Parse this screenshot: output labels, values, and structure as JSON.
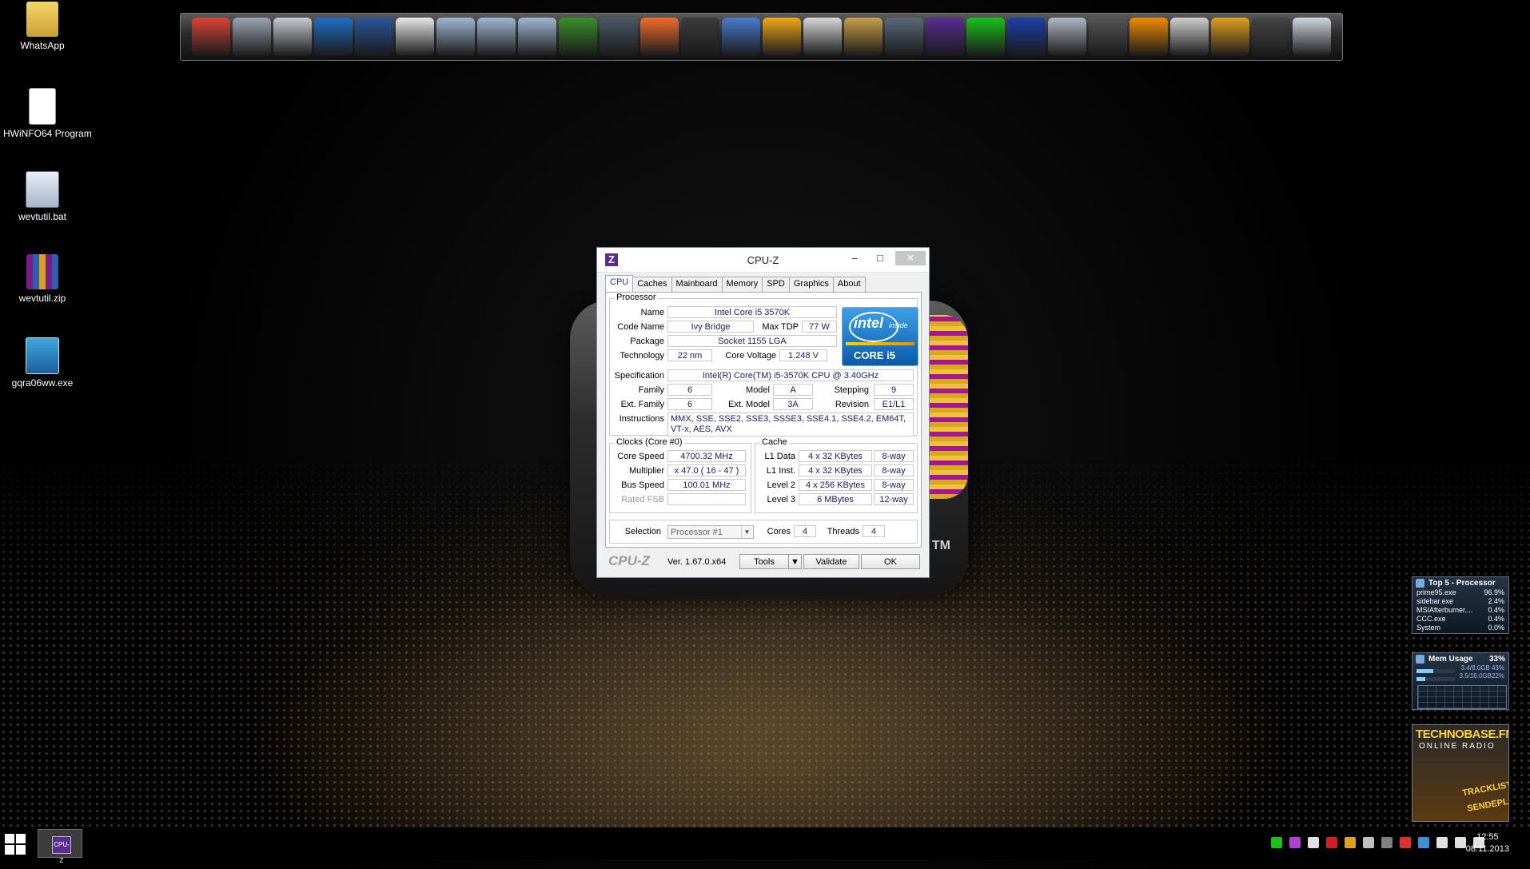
{
  "desktop": {
    "icons": [
      {
        "label": "WhatsApp",
        "icon": "folder-icon"
      },
      {
        "label": "HWiNFO64 Program",
        "icon": "document-icon"
      },
      {
        "label": "wevtutil.bat",
        "icon": "batch-file-icon"
      },
      {
        "label": "wevtutil.zip",
        "icon": "archive-icon"
      },
      {
        "label": "gqra06ww.exe",
        "icon": "installer-icon"
      }
    ]
  },
  "dock": {
    "icons": [
      {
        "name": "chrome-icon",
        "color": "#db4437"
      },
      {
        "name": "drive-icon",
        "color": "#9aa4b0"
      },
      {
        "name": "drive-icon",
        "color": "#c7ccd2"
      },
      {
        "name": "outlook-icon",
        "color": "#1f6fc5"
      },
      {
        "name": "word-icon",
        "color": "#2b579a"
      },
      {
        "name": "document-icon",
        "color": "#e8e8e8"
      },
      {
        "name": "folder-icon",
        "color": "#9fb7d4"
      },
      {
        "name": "folder-icon",
        "color": "#9fb7d4"
      },
      {
        "name": "folder-icon",
        "color": "#9fb7d4"
      },
      {
        "name": "xbox-icon",
        "color": "#3a8f2b"
      },
      {
        "name": "soldier-icon",
        "color": "#4a5a66"
      },
      {
        "name": "origin-icon",
        "color": "#f56c2d"
      },
      {
        "name": "game-character-icon",
        "color": "#3b3b3b"
      },
      {
        "name": "monitor-icon",
        "color": "#4a7bd0"
      },
      {
        "name": "gamepad-icon",
        "color": "#f0a818"
      },
      {
        "name": "benchmark-icon",
        "color": "#d9d9d9"
      },
      {
        "name": "hardware-monitor-icon",
        "color": "#c8a04a"
      },
      {
        "name": "audio-icon",
        "color": "#5a6a7a"
      },
      {
        "name": "cpu-z-icon",
        "color": "#5a2d91"
      },
      {
        "name": "prime95-icon",
        "color": "#19c219"
      },
      {
        "name": "lightning-icon",
        "color": "#1c3fa8"
      },
      {
        "name": "tool-icon",
        "color": "#b0b8c4"
      },
      {
        "name": "usb-icon",
        "color": "#555555"
      },
      {
        "name": "vlc-icon",
        "color": "#f08a00"
      },
      {
        "name": "network-icon",
        "color": "#cfcfcf"
      },
      {
        "name": "settings-icon",
        "color": "#e0a020"
      },
      {
        "name": "display-icon",
        "color": "#444444"
      },
      {
        "name": "recycle-bin-icon",
        "color": "#cfd8e0"
      }
    ]
  },
  "cpuz": {
    "title": "CPU-Z",
    "logo": "Z",
    "minimize": "–",
    "maximize": "□",
    "close": "✕",
    "tabs": [
      "CPU",
      "Caches",
      "Mainboard",
      "Memory",
      "SPD",
      "Graphics",
      "About"
    ],
    "processor": {
      "group": "Processor",
      "name_label": "Name",
      "name": "Intel Core i5 3570K",
      "code_name_label": "Code Name",
      "code_name": "Ivy Bridge",
      "max_tdp_label": "Max TDP",
      "max_tdp": "77 W",
      "package_label": "Package",
      "package": "Socket 1155 LGA",
      "technology_label": "Technology",
      "technology": "22 nm",
      "core_voltage_label": "Core Voltage",
      "core_voltage": "1.248 V",
      "specification_label": "Specification",
      "specification": "Intel(R) Core(TM) i5-3570K CPU @ 3.40GHz",
      "family_label": "Family",
      "family": "6",
      "model_label": "Model",
      "model": "A",
      "stepping_label": "Stepping",
      "stepping": "9",
      "ext_family_label": "Ext. Family",
      "ext_family": "6",
      "ext_model_label": "Ext. Model",
      "ext_model": "3A",
      "revision_label": "Revision",
      "revision": "E1/L1",
      "instructions_label": "Instructions",
      "instructions": "MMX, SSE, SSE2, SSE3, SSSE3, SSE4.1, SSE4.2, EM64T, VT-x, AES, AVX"
    },
    "badge": {
      "intel": "intel",
      "inside": "inside",
      "core": "CORE i5"
    },
    "clocks": {
      "group": "Clocks (Core #0)",
      "core_speed_label": "Core Speed",
      "core_speed": "4700.32 MHz",
      "multiplier_label": "Multiplier",
      "multiplier": "x 47.0 ( 16 - 47 )",
      "bus_speed_label": "Bus Speed",
      "bus_speed": "100.01 MHz",
      "rated_fsb_label": "Rated FSB",
      "rated_fsb": ""
    },
    "cache": {
      "group": "Cache",
      "rows": [
        {
          "label": "L1 Data",
          "size": "4 x 32 KBytes",
          "way": "8-way"
        },
        {
          "label": "L1 Inst.",
          "size": "4 x 32 KBytes",
          "way": "8-way"
        },
        {
          "label": "Level 2",
          "size": "4 x 256 KBytes",
          "way": "8-way"
        },
        {
          "label": "Level 3",
          "size": "6 MBytes",
          "way": "12-way"
        }
      ]
    },
    "selection": {
      "label": "Selection",
      "value": "Processor #1",
      "cores_label": "Cores",
      "cores": "4",
      "threads_label": "Threads",
      "threads": "4"
    },
    "footer": {
      "brand": "CPU-Z",
      "version": "Ver. 1.67.0.x64",
      "tools": "Tools",
      "validate": "Validate",
      "ok": "OK"
    }
  },
  "gadgets": {
    "top5": {
      "title": "Top 5 - Processor",
      "rows": [
        {
          "name": "prime95.exe",
          "value": "96.9%"
        },
        {
          "name": "sidebar.exe",
          "value": "2.4%"
        },
        {
          "name": "MSIAfterburner....",
          "value": "0.4%"
        },
        {
          "name": "CCC.exe",
          "value": "0.4%"
        },
        {
          "name": "System",
          "value": "0.0%"
        }
      ]
    },
    "mem": {
      "title": "Mem Usage",
      "percent": "33%",
      "row1": "3.4/8.0GB 43%",
      "row1_fill": 43,
      "row2": "3.5/16.0GB22%",
      "row2_fill": 22
    },
    "radio": {
      "title": "TECHNOBASE.FM",
      "subtitle": "ONLINE RADIO",
      "line1": "TRACKLIST",
      "line2": "SENDEPLAN"
    }
  },
  "taskbar": {
    "clock_time": "12:55",
    "clock_date": "08.11.2013",
    "task_label": "CPU-Z",
    "tray": [
      {
        "name": "prime95-tray-icon",
        "color": "#19c219"
      },
      {
        "name": "network-tray-icon",
        "color": "#b040d0"
      },
      {
        "name": "plane-tray-icon",
        "color": "#e0e0e0"
      },
      {
        "name": "ati-tray-icon",
        "color": "#d02020"
      },
      {
        "name": "msi-tray-icon",
        "color": "#e0a020"
      },
      {
        "name": "app-tray-icon",
        "color": "#c0c0c0"
      },
      {
        "name": "battery-tray-icon",
        "color": "#808080"
      },
      {
        "name": "speaker-red-tray-icon",
        "color": "#e03030"
      },
      {
        "name": "cloud-tray-icon",
        "color": "#3d8fd8"
      },
      {
        "name": "flag-tray-icon",
        "color": "#e0e0e0"
      },
      {
        "name": "network-monitor-tray-icon",
        "color": "#e0e0e0"
      },
      {
        "name": "volume-tray-icon",
        "color": "#e0e0e0"
      }
    ]
  }
}
